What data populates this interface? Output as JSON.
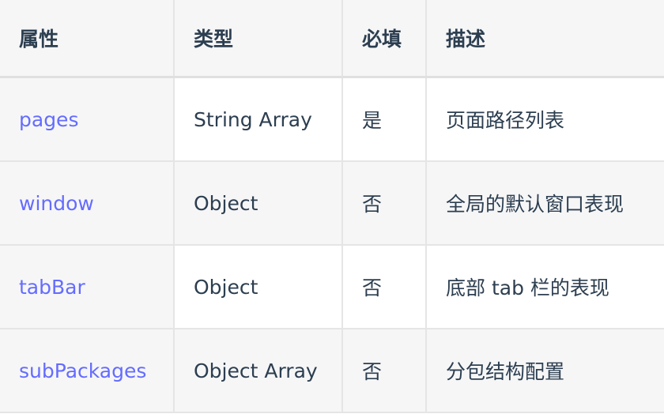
{
  "table": {
    "headers": [
      "属性",
      "类型",
      "必填",
      "描述"
    ],
    "rows": [
      {
        "name": "pages",
        "type": "String Array",
        "required": "是",
        "description": "页面路径列表"
      },
      {
        "name": "window",
        "type": "Object",
        "required": "否",
        "description": "全局的默认窗口表现"
      },
      {
        "name": "tabBar",
        "type": "Object",
        "required": "否",
        "description": "底部 tab 栏的表现"
      },
      {
        "name": "subPackages",
        "type": "Object Array",
        "required": "否",
        "description": "分包结构配置"
      }
    ]
  },
  "colors": {
    "link": "#646cff",
    "text": "#2c3e50",
    "header_bg": "#f6f6f7",
    "border": "#e5e5e5"
  }
}
